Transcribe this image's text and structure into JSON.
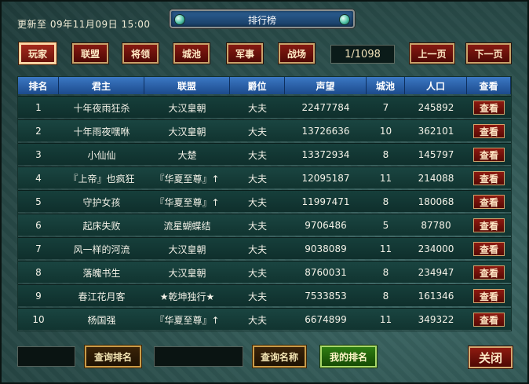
{
  "header": {
    "update_text": "更新至 09年11月09日 15:00",
    "title": "排行榜"
  },
  "tabs": [
    {
      "label": "玩家",
      "active": true
    },
    {
      "label": "联盟",
      "active": false
    },
    {
      "label": "将领",
      "active": false
    },
    {
      "label": "城池",
      "active": false
    },
    {
      "label": "军事",
      "active": false
    },
    {
      "label": "战场",
      "active": false
    }
  ],
  "pagination": {
    "indicator": "1/1098",
    "prev_label": "上一页",
    "next_label": "下一页"
  },
  "table": {
    "columns": [
      "排名",
      "君主",
      "联盟",
      "爵位",
      "声望",
      "城池",
      "人口",
      "查看"
    ],
    "view_label": "查看",
    "rows": [
      {
        "rank": "1",
        "lord": "十年夜雨狂杀",
        "alliance": "大汉皇朝",
        "title": "大夫",
        "prestige": "22477784",
        "cities": "7",
        "population": "245892"
      },
      {
        "rank": "2",
        "lord": "十年雨夜嘿咻",
        "alliance": "大汉皇朝",
        "title": "大夫",
        "prestige": "13726636",
        "cities": "10",
        "population": "362101"
      },
      {
        "rank": "3",
        "lord": "小仙仙",
        "alliance": "大楚",
        "title": "大夫",
        "prestige": "13372934",
        "cities": "8",
        "population": "145797"
      },
      {
        "rank": "4",
        "lord": "『上帝』也疯狂",
        "alliance": "『华夏至尊』↑",
        "title": "大夫",
        "prestige": "12095187",
        "cities": "11",
        "population": "214088"
      },
      {
        "rank": "5",
        "lord": "守护女孩",
        "alliance": "『华夏至尊』↑",
        "title": "大夫",
        "prestige": "11997471",
        "cities": "8",
        "population": "180068"
      },
      {
        "rank": "6",
        "lord": "起床失败",
        "alliance": "流星蝴蝶结",
        "title": "大夫",
        "prestige": "9706486",
        "cities": "5",
        "population": "87780"
      },
      {
        "rank": "7",
        "lord": "风一样的河流",
        "alliance": "大汉皇朝",
        "title": "大夫",
        "prestige": "9038089",
        "cities": "11",
        "population": "234000"
      },
      {
        "rank": "8",
        "lord": "落魄书生",
        "alliance": "大汉皇朝",
        "title": "大夫",
        "prestige": "8760031",
        "cities": "8",
        "population": "234947"
      },
      {
        "rank": "9",
        "lord": "春江花月客",
        "alliance": "★乾坤独行★",
        "title": "大夫",
        "prestige": "7533853",
        "cities": "8",
        "population": "161346"
      },
      {
        "rank": "10",
        "lord": "杨国强",
        "alliance": "『华夏至尊』↑",
        "title": "大夫",
        "prestige": "6674899",
        "cities": "11",
        "population": "349322"
      }
    ]
  },
  "footer": {
    "rank_query_value": "",
    "rank_query_label": "查询排名",
    "name_query_value": "",
    "name_query_label": "查询名称",
    "my_rank_label": "我的排名",
    "close_label": "关闭"
  }
}
